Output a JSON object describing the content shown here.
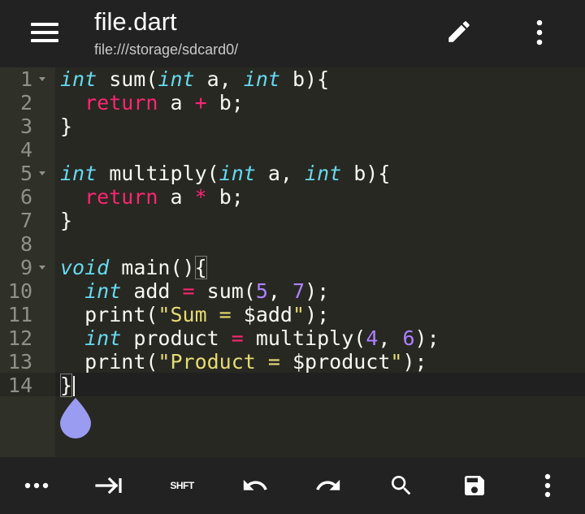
{
  "app_bar": {
    "title": "file.dart",
    "subtitle": "file:///storage/sdcard0/",
    "icons": [
      "menu-icon",
      "pencil-icon",
      "more-vertical-icon"
    ]
  },
  "editor": {
    "line_numbers": [
      "1",
      "2",
      "3",
      "4",
      "5",
      "6",
      "7",
      "8",
      "9",
      "10",
      "11",
      "12",
      "13",
      "14"
    ],
    "foldable_lines": [
      "1",
      "5",
      "9"
    ],
    "active_line": "14",
    "code": {
      "l1": {
        "type": "int",
        "name": " sum(",
        "type2": "int",
        "p1": " a, ",
        "type3": "int",
        "p2": " b){"
      },
      "l2": {
        "indent": "  ",
        "kw": "return",
        "a": " a ",
        "op": "+",
        "b": " b;"
      },
      "l3": {
        "text": "}"
      },
      "l5": {
        "type": "int",
        "name": " multiply(",
        "type2": "int",
        "p1": " a, ",
        "type3": "int",
        "p2": " b){"
      },
      "l6": {
        "indent": "  ",
        "kw": "return",
        "a": " a ",
        "op": "*",
        "b": " b;"
      },
      "l7": {
        "text": "}"
      },
      "l9": {
        "type": "void",
        "name": " main()",
        "brace": "{"
      },
      "l10": {
        "indent": "  ",
        "type": "int",
        "a": " add ",
        "op": "=",
        "call": " sum(",
        "n1": "5",
        "sep": ", ",
        "n2": "7",
        "end": ");"
      },
      "l11": {
        "indent": "  ",
        "fn": "print(",
        "str": "\"Sum = ",
        "var": "$add",
        "q": "\"",
        "end": ");"
      },
      "l12": {
        "indent": "  ",
        "type": "int",
        "a": " product ",
        "op": "=",
        "call": " multiply(",
        "n1": "4",
        "sep": ", ",
        "n2": "6",
        "end": ");"
      },
      "l13": {
        "indent": "  ",
        "fn": "print(",
        "str": "\"Product = ",
        "var": "$product",
        "q": "\"",
        "end": ");"
      },
      "l14": {
        "brace": "}"
      }
    }
  },
  "bottom_toolbar": {
    "shift_label": "SHFT",
    "icons": [
      "more-horizontal-icon",
      "tab-icon",
      "shift-key",
      "undo-icon",
      "redo-icon",
      "search-icon",
      "save-icon",
      "more-vertical-icon"
    ]
  },
  "colors": {
    "app_bar": "#222222",
    "editor_background": "#272822",
    "gutter": "#2f3129",
    "keyword_type": "#66d9ef",
    "keyword_control": "#f92672",
    "number": "#ae81ff",
    "string": "#e6db74",
    "handle": "#9a9cf2"
  }
}
